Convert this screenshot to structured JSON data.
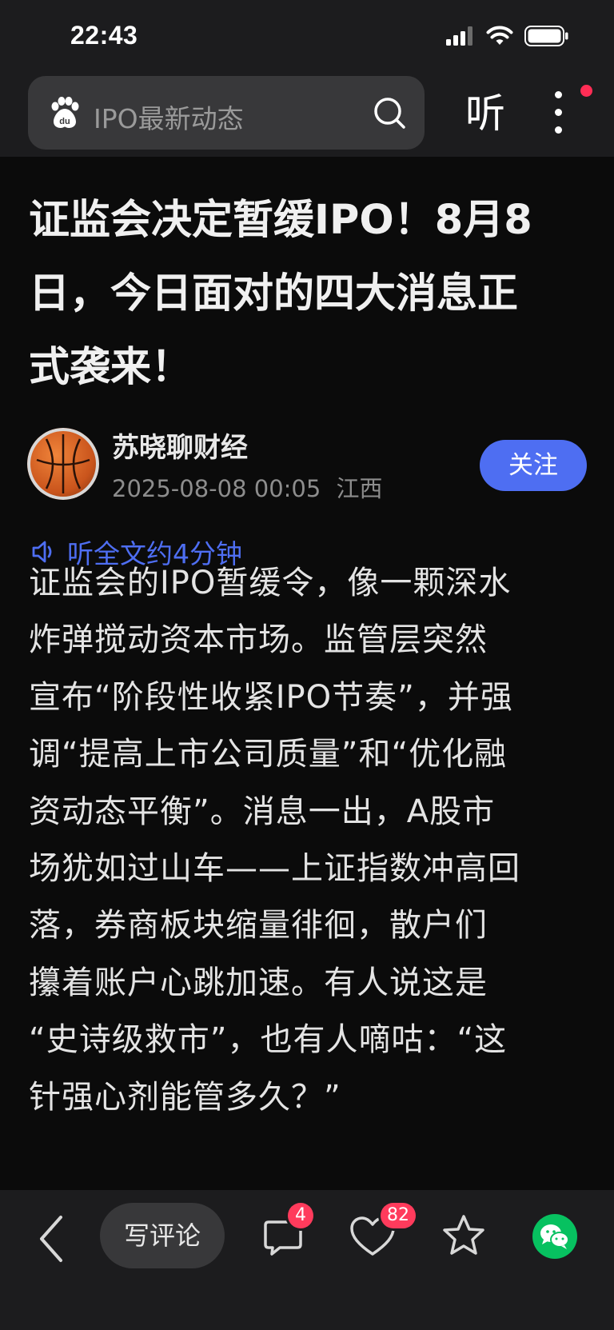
{
  "status_bar": {
    "time": "22:43"
  },
  "header": {
    "search_placeholder": "IPO最新动态",
    "listen_label": "听"
  },
  "article": {
    "title_lines": [
      "证监会决定暂缓IPO！8月8",
      "日，今日面对的四大消息正",
      "式袭来！"
    ],
    "author": {
      "name": "苏晓聊财经",
      "date": "2025-08-08 00:05",
      "location": "江西"
    },
    "follow_label": "关注",
    "listen_full_label": "听全文约4分钟",
    "body_lines": [
      "证监会的IPO暂缓令，像一颗深水",
      "炸弹搅动资本市场。监管层突然",
      "宣布“阶段性收紧IPO节奏”，并强",
      "调“提高上市公司质量”和“优化融",
      "资动态平衡”。消息一出，A股市",
      "场犹如过山车——上证指数冲高回",
      "落，券商板块缩量徘徊，散户们",
      "攥着账户心跳加速。有人说这是",
      "“史诗级救市”，也有人嘀咕：“这",
      "针强心剂能管多久？”"
    ]
  },
  "bottom_bar": {
    "comment_placeholder": "写评论",
    "comment_count": "4",
    "like_count": "82"
  },
  "colors": {
    "accent": "#4e6ef2",
    "badge": "#ff3b5c",
    "wechat": "#07c160",
    "background": "#0b0b0b",
    "bar": "#1c1c1e"
  }
}
